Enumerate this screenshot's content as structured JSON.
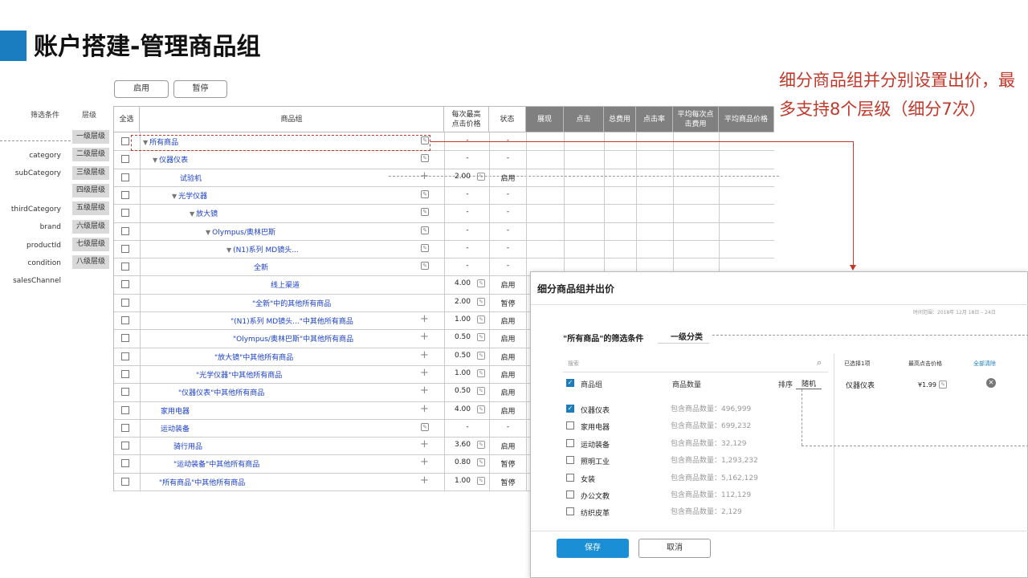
{
  "page_title": "账户搭建-管理商品组",
  "note": "细分商品组并分别设置出价，最多支持8个层级（细分7次）",
  "buttons": {
    "enable": "启用",
    "pause": "暂停"
  },
  "side": {
    "filter_header": "筛选条件",
    "level_header": "层级",
    "filters": [
      "category",
      "subCategory",
      "thirdCategory",
      "brand",
      "productId",
      "condition",
      "salesChannel"
    ],
    "levels": [
      "一级层级",
      "二级层级",
      "三级层级",
      "四级层级",
      "五级层级",
      "六级层级",
      "七级层级",
      "八级层级"
    ]
  },
  "table": {
    "headers": {
      "select_all": "全选",
      "group": "商品组",
      "max_bid": "每次最高点击价格",
      "status": "状态",
      "impressions": "展现",
      "clicks": "点击",
      "cost": "总费用",
      "ctr": "点击率",
      "avg_cpc": "平均每次点击费用",
      "avg_price": "平均商品价格"
    },
    "rows": [
      {
        "name": "所有商品",
        "tri": "▼",
        "action": "edit",
        "bid": "-",
        "status": "-"
      },
      {
        "name": "仪器仪表",
        "tri": "▼",
        "action": "edit",
        "bid": "-",
        "status": "-"
      },
      {
        "name": "试验机",
        "tri": "",
        "action": "plus",
        "bid": "2.00",
        "status": "启用"
      },
      {
        "name": "光学仪器",
        "tri": "▼",
        "action": "edit",
        "bid": "-",
        "status": "-"
      },
      {
        "name": "放大镜",
        "tri": "▼",
        "action": "edit",
        "bid": "-",
        "status": "-"
      },
      {
        "name": "Olympus/奥林巴斯",
        "tri": "▼",
        "action": "edit",
        "bid": "-",
        "status": "-"
      },
      {
        "name": "(N1)系列 MD镜头...",
        "tri": "▼",
        "action": "edit",
        "bid": "-",
        "status": "-"
      },
      {
        "name": "全新",
        "tri": "",
        "action": "edit",
        "bid": "-",
        "status": "-"
      },
      {
        "name": "线上渠道",
        "tri": "",
        "action": "none",
        "bid": "4.00",
        "status": "启用"
      },
      {
        "name": "\"全新\"中的其他所有商品",
        "tri": "",
        "action": "none",
        "bid": "2.00",
        "status": "暂停"
      },
      {
        "name": "\"(N1)系列 MD镜头...\"中其他所有商品",
        "tri": "",
        "action": "plus",
        "bid": "1.00",
        "status": "启用"
      },
      {
        "name": "\"Olympus/奥林巴斯\"中其他所有商品",
        "tri": "",
        "action": "plus",
        "bid": "0.50",
        "status": "启用"
      },
      {
        "name": "\"放大镜\"中其他所有商品",
        "tri": "",
        "action": "plus",
        "bid": "0.50",
        "status": "启用"
      },
      {
        "name": "\"光学仪器\"中其他所有商品",
        "tri": "",
        "action": "plus",
        "bid": "1.00",
        "status": "启用"
      },
      {
        "name": "\"仪器仪表\"中其他所有商品",
        "tri": "",
        "action": "plus",
        "bid": "0.50",
        "status": "启用"
      },
      {
        "name": "家用电器",
        "tri": "",
        "action": "plus",
        "bid": "4.00",
        "status": "启用"
      },
      {
        "name": "运动装备",
        "tri": "",
        "action": "edit",
        "bid": "-",
        "status": "-"
      },
      {
        "name": "骑行用品",
        "tri": "",
        "action": "plus",
        "bid": "3.60",
        "status": "启用"
      },
      {
        "name": "\"运动装备\"中其他所有商品",
        "tri": "",
        "action": "plus",
        "bid": "0.80",
        "status": "暂停"
      },
      {
        "name": "\"所有商品\"中其他所有商品",
        "tri": "",
        "action": "plus",
        "bid": "1.00",
        "status": "暂停"
      }
    ]
  },
  "dialog": {
    "title": "细分商品组并出价",
    "time_range": "时间范围：2018年 12月 18日 – 24日",
    "filter_label": "\"所有商品\"的筛选条件",
    "category": "一级分类",
    "search_placeholder": "搜索",
    "col_group": "商品组",
    "col_count": "商品数量",
    "sort_label": "排序",
    "sort_value": "随机",
    "selected_count": "已选择1项",
    "col_max_price": "最高点击价格",
    "clear_all": "全部清除",
    "items": [
      {
        "name": "仪器仪表",
        "count": "包含商品数量：496,999",
        "checked": true
      },
      {
        "name": "家用电器",
        "count": "包含商品数量：699,232",
        "checked": false
      },
      {
        "name": "运动装备",
        "count": "包含商品数量：32,129",
        "checked": false
      },
      {
        "name": "照明工业",
        "count": "包含商品数量：1,293,232",
        "checked": false
      },
      {
        "name": "女装",
        "count": "包含商品数量：5,162,129",
        "checked": false
      },
      {
        "name": "办公文教",
        "count": "包含商品数量：112,129",
        "checked": false
      },
      {
        "name": "纺织皮革",
        "count": "包含商品数量：2,129",
        "checked": false
      }
    ],
    "selected": {
      "name": "仪器仪表",
      "price": "¥1.99"
    },
    "save": "保存",
    "cancel": "取消"
  }
}
